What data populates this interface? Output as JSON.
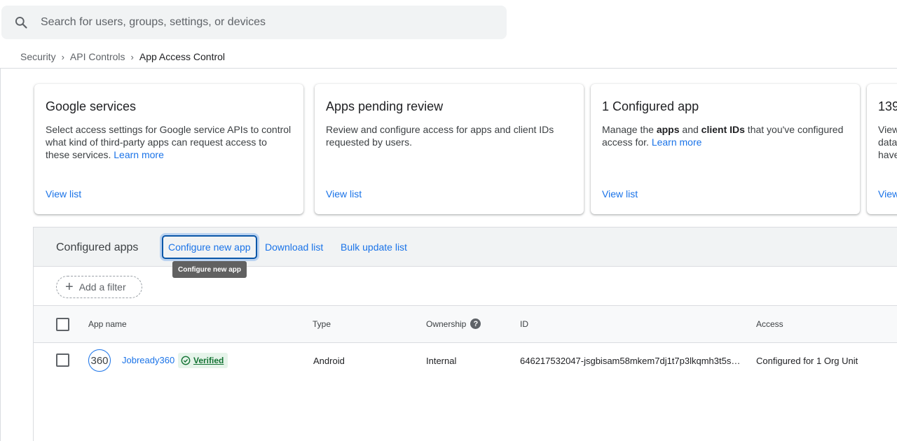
{
  "search": {
    "placeholder": "Search for users, groups, settings, or devices",
    "icon": "search-icon"
  },
  "breadcrumb": {
    "items": [
      "Security",
      "API Controls"
    ],
    "current": "App Access Control"
  },
  "cards": [
    {
      "title": "Google services",
      "desc_parts": [
        "Select access settings for Google service APIs to control what kind of third-party apps can request access to these services. "
      ],
      "learn_more": "Learn more",
      "view": "View list"
    },
    {
      "title": "Apps pending review",
      "desc": "Review and configure access for apps and client IDs requested by users.",
      "view": "View list"
    },
    {
      "title": "1 Configured app",
      "desc_parts": [
        "Manage the ",
        "apps",
        " and ",
        "client IDs",
        " that you've configured access for. "
      ],
      "learn_more": "Learn more",
      "view": "View list"
    },
    {
      "title": "139",
      "desc_lines": [
        "View",
        "data",
        "have"
      ],
      "view": "View"
    }
  ],
  "panel": {
    "title": "Configured apps",
    "buttons": {
      "configure": "Configure new app",
      "download": "Download list",
      "bulk": "Bulk update list"
    },
    "tooltip": "Configure new app",
    "filter": {
      "label": "Add a filter",
      "icon": "plus-icon"
    }
  },
  "table": {
    "headers": {
      "app_name": "App name",
      "type": "Type",
      "ownership": "Ownership",
      "id": "ID",
      "access": "Access"
    },
    "help_icon": "?",
    "rows": [
      {
        "icon_text": "360",
        "name": "Jobready360",
        "badge": "Verified",
        "type": "Android",
        "ownership": "Internal",
        "id": "646217532047-jsgbisam58mkem7dj1t7p3lkqmh3t5s…",
        "access": "Configured for 1 Org Unit"
      }
    ]
  },
  "colors": {
    "accent": "#1a73e8",
    "verified_bg": "#e6f4ea",
    "verified_fg": "#137333"
  }
}
